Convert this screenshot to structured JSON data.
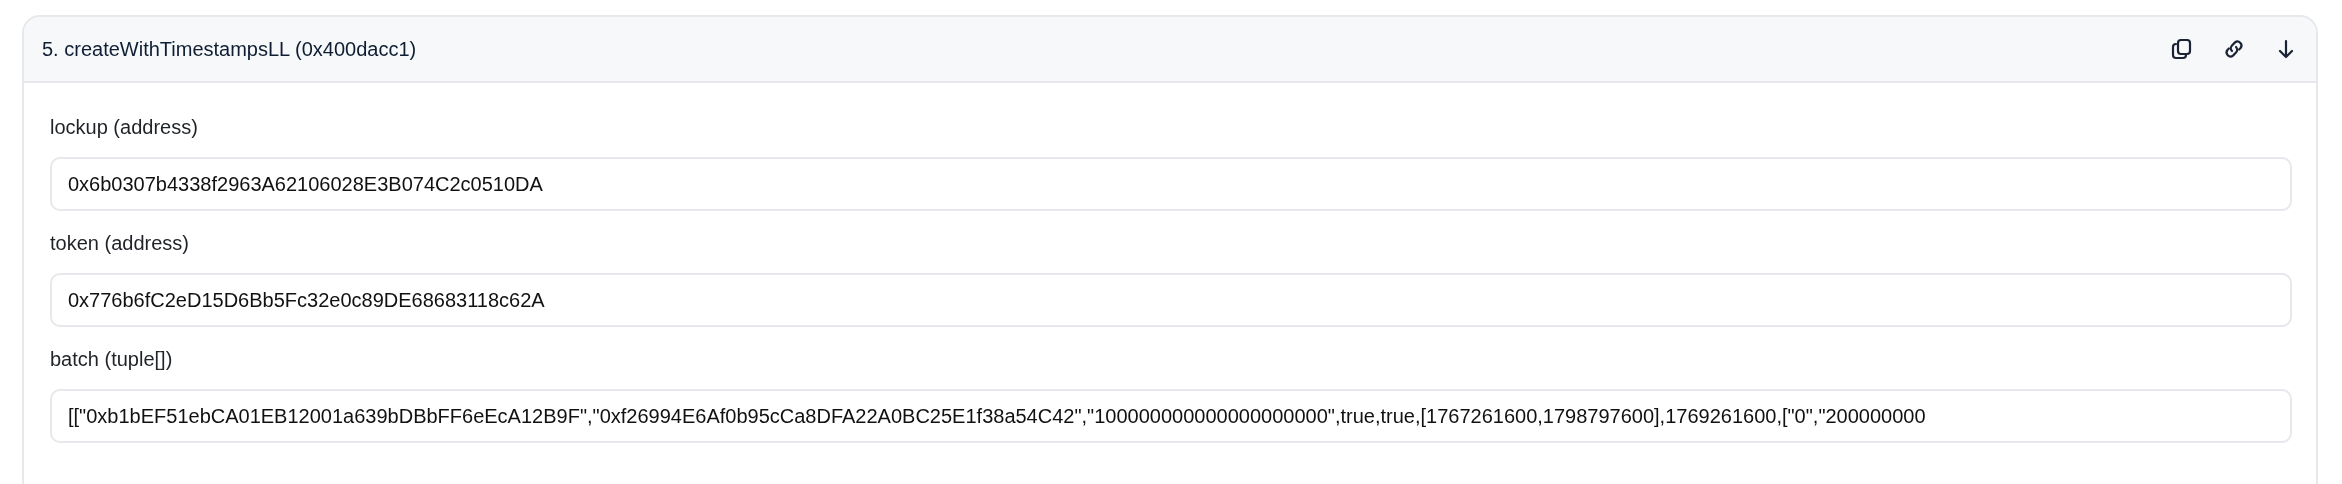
{
  "panel": {
    "title": "5. createWithTimestampsLL (0x400dacc1)",
    "actions": [
      {
        "kind": "copy"
      },
      {
        "kind": "link"
      },
      {
        "kind": "download"
      }
    ],
    "params": [
      {
        "label": "lockup (address)",
        "value": "0x6b0307b4338f2963A62106028E3B074C2c0510DA"
      },
      {
        "label": "token (address)",
        "value": "0x776b6fC2eD15D6Bb5Fc32e0c89DE68683118c62A"
      },
      {
        "label": "batch (tuple[])",
        "value": "[[\"0xb1bEF51ebCA01EB12001a639bDBbFF6eEcA12B9F\",\"0xf26994E6Af0b95cCa8DFA22A0BC25E1f38a54C42\",\"100000000000000000000\",true,true,[1767261600,1798797600],1769261600,[\"0\",\"200000000"
      }
    ]
  }
}
